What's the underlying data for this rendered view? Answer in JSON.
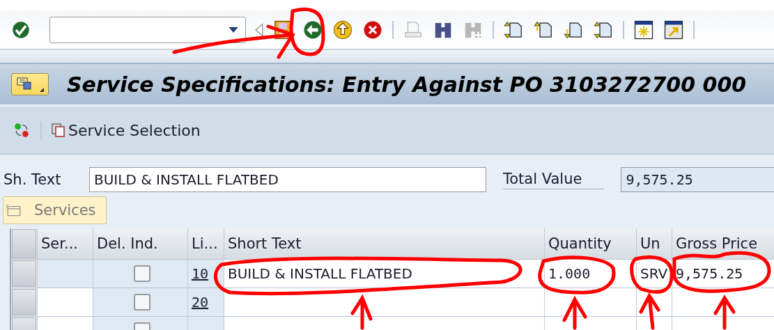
{
  "toolbar": {
    "button_groups": [
      [
        {
          "kind": "save",
          "disabled": false
        },
        {
          "kind": "back",
          "disabled": false
        },
        {
          "kind": "exit",
          "disabled": false
        },
        {
          "kind": "cancel",
          "disabled": false
        }
      ],
      [
        {
          "kind": "print",
          "disabled": true
        },
        {
          "kind": "find",
          "disabled": false
        },
        {
          "kind": "find-next",
          "disabled": true
        }
      ],
      [
        {
          "kind": "first-page",
          "disabled": false
        },
        {
          "kind": "prev-page",
          "disabled": false
        },
        {
          "kind": "next-page",
          "disabled": false
        },
        {
          "kind": "last-page",
          "disabled": false
        }
      ],
      [
        {
          "kind": "new-session",
          "disabled": false
        },
        {
          "kind": "shortcut",
          "disabled": false
        }
      ]
    ]
  },
  "title": "Service Specifications: Entry Against PO 3103272700 000",
  "app_toolbar": [
    {
      "kind": "other-lines"
    },
    {
      "kind": "selection",
      "label": "Service Selection"
    }
  ],
  "header": {
    "short_text": {
      "label": "Sh. Text",
      "value": "BUILD & INSTALL FLATBED"
    },
    "total_value": {
      "label": "Total Value",
      "value": "9,575.25"
    }
  },
  "tabs": [
    {
      "label": "Services",
      "selected": true
    }
  ],
  "table": {
    "columns": [
      "Ser...",
      "Del. Ind.",
      "Li...",
      "Short Text",
      "Quantity",
      "Un",
      "Gross Price"
    ],
    "rows": [
      {
        "del_ind": false,
        "line": "10",
        "short_text": "BUILD & INSTALL FLATBED",
        "quantity": "1.000",
        "unit": "SRV",
        "gross_price": "9,575.25"
      },
      {
        "del_ind": false,
        "line": "20"
      },
      {
        "del_ind": false
      }
    ]
  }
}
